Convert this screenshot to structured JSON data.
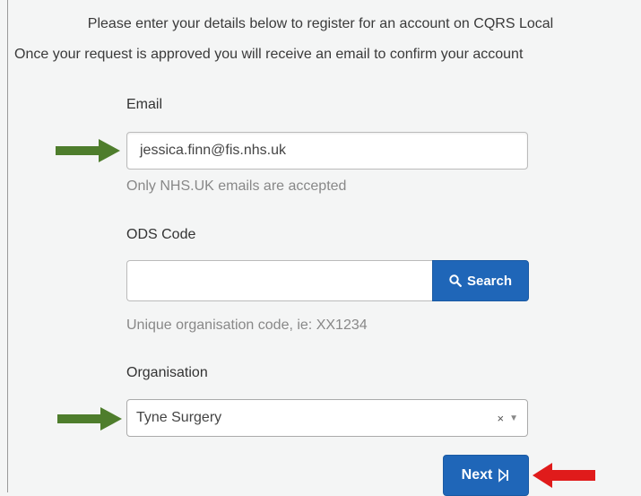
{
  "intro": {
    "line1": "Please enter your details below to register for an account on CQRS Local",
    "line2": "Once your request is approved you will receive an email to confirm your account"
  },
  "email": {
    "label": "Email",
    "value": "jessica.finn@fis.nhs.uk",
    "hint": "Only NHS.UK emails are accepted"
  },
  "ods": {
    "label": "ODS Code",
    "value": "",
    "search_label": "Search",
    "hint": "Unique organisation code, ie: XX1234"
  },
  "organisation": {
    "label": "Organisation",
    "selected": "Tyne Surgery",
    "clear_symbol": "×",
    "caret_symbol": "▼"
  },
  "next_label": "Next",
  "colors": {
    "primary": "#1f66b8",
    "arrow_green": "#4e7d2c",
    "arrow_red": "#e01b1b"
  }
}
